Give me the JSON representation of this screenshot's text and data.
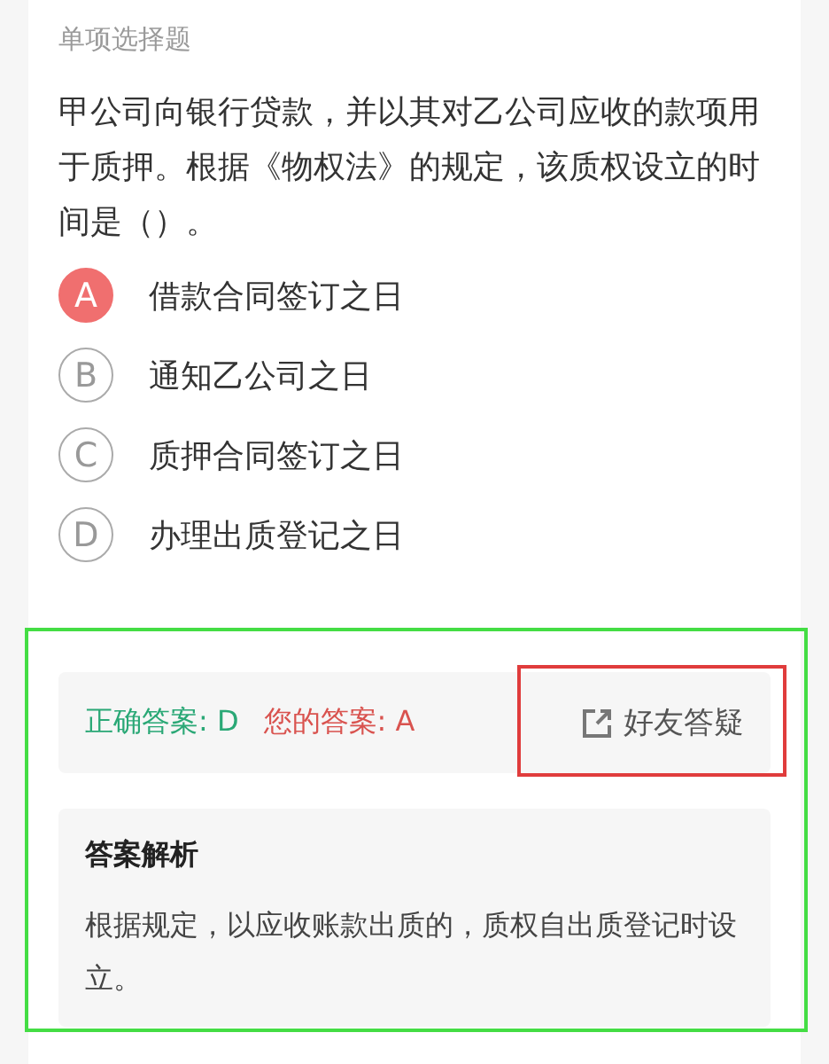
{
  "question_type": "单项选择题",
  "question": "甲公司向银行贷款，并以其对乙公司应收的款项用于质押。根据《物权法》的规定，该质权设立的时间是（）。",
  "options": [
    {
      "letter": "A",
      "text": "借款合同签订之日",
      "selected": true
    },
    {
      "letter": "B",
      "text": "通知乙公司之日",
      "selected": false
    },
    {
      "letter": "C",
      "text": "质押合同签订之日",
      "selected": false
    },
    {
      "letter": "D",
      "text": "办理出质登记之日",
      "selected": false
    }
  ],
  "result": {
    "correct_answer": "正确答案: D",
    "your_answer": "您的答案: A",
    "ask_button": "好友答疑"
  },
  "analysis": {
    "title": "答案解析",
    "text": "根据规定，以应收账款出质的，质权自出质登记时设立。"
  },
  "highlight_frames": [
    {
      "kind": "result",
      "color": "#44dd44"
    },
    {
      "kind": "button",
      "color": "#e03c3c"
    }
  ]
}
